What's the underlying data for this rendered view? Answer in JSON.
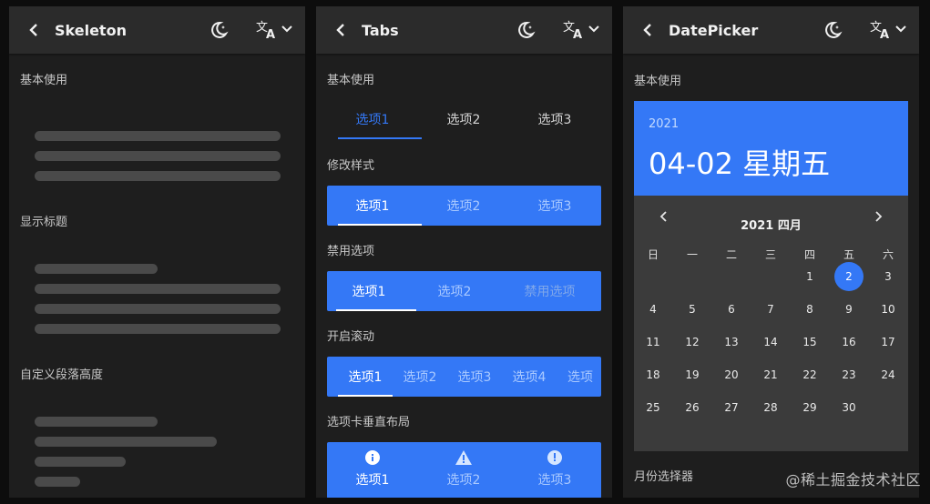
{
  "panels": {
    "skeleton": {
      "title": "Skeleton",
      "sections": [
        "基本使用",
        "显示标题",
        "自定义段落高度"
      ]
    },
    "tabs": {
      "title": "Tabs",
      "sections": [
        "基本使用",
        "修改样式",
        "禁用选项",
        "开启滚动",
        "选项卡垂直布局"
      ],
      "basic": [
        "选项1",
        "选项2",
        "选项3"
      ],
      "styled": [
        "选项1",
        "选项2",
        "选项3"
      ],
      "disabled": [
        "选项1",
        "选项2",
        "禁用选项"
      ],
      "scroll": [
        "选项1",
        "选项2",
        "选项3",
        "选项4",
        "选项"
      ],
      "vertical": [
        {
          "label": "选项1",
          "icon": "info-icon"
        },
        {
          "label": "选项2",
          "icon": "warning-icon"
        },
        {
          "label": "选项3",
          "icon": "alert-icon"
        }
      ]
    },
    "datepicker": {
      "title": "DatePicker",
      "section": "基本使用",
      "section2": "月份选择器",
      "year": "2021",
      "date": "04-02 星期五",
      "month_label": "2021 四月",
      "weekdays": [
        "日",
        "一",
        "二",
        "三",
        "四",
        "五",
        "六"
      ],
      "days": [
        "1",
        "2",
        "3",
        "4",
        "5",
        "6",
        "7",
        "8",
        "9",
        "10",
        "11",
        "12",
        "13",
        "14",
        "15",
        "16",
        "17",
        "18",
        "19",
        "20",
        "21",
        "22",
        "23",
        "24",
        "25",
        "26",
        "27",
        "28",
        "29",
        "30"
      ],
      "first_weekday_index": 4,
      "selected_day": "2"
    }
  },
  "watermark": "@稀土掘金技术社区",
  "colors": {
    "accent": "#3478f6",
    "panel_bg": "#1e1e1e",
    "topbar_bg": "#2b2b2b",
    "skeleton": "#4a4a4a"
  }
}
